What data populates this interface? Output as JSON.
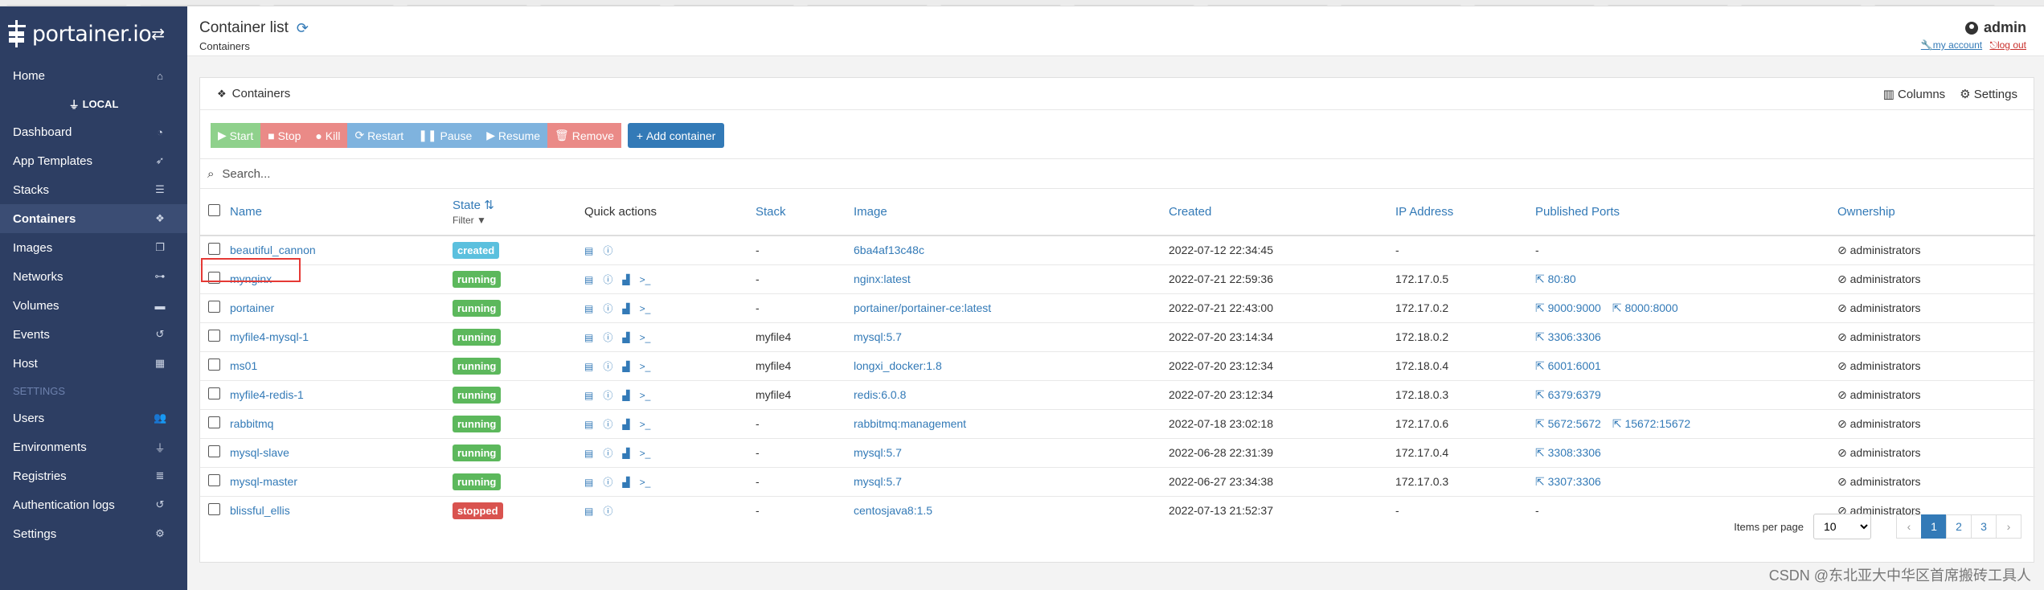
{
  "sidebar": {
    "brand": "portainer.io",
    "environment": "LOCAL",
    "settings_section": "SETTINGS",
    "items": [
      {
        "label": "Home",
        "icon": "home-icon"
      },
      {
        "label": "Dashboard",
        "icon": "tachometer-icon"
      },
      {
        "label": "App Templates",
        "icon": "rocket-icon"
      },
      {
        "label": "Stacks",
        "icon": "list-icon"
      },
      {
        "label": "Containers",
        "icon": "cubes-icon"
      },
      {
        "label": "Images",
        "icon": "clone-icon"
      },
      {
        "label": "Networks",
        "icon": "sitemap-icon"
      },
      {
        "label": "Volumes",
        "icon": "hdd-icon"
      },
      {
        "label": "Events",
        "icon": "history-icon"
      },
      {
        "label": "Host",
        "icon": "th-icon"
      }
    ],
    "settings_items": [
      {
        "label": "Users",
        "icon": "users-icon"
      },
      {
        "label": "Environments",
        "icon": "plug-icon"
      },
      {
        "label": "Registries",
        "icon": "database-icon"
      },
      {
        "label": "Authentication logs",
        "icon": "history-icon"
      },
      {
        "label": "Settings",
        "icon": "cogs-icon"
      }
    ]
  },
  "header": {
    "title": "Container list",
    "breadcrumb": "Containers",
    "user": "admin",
    "my_account": "my account",
    "log_out": "log out"
  },
  "panel": {
    "title": "Containers",
    "columns_label": "Columns",
    "settings_label": "Settings"
  },
  "toolbar": {
    "start": "Start",
    "stop": "Stop",
    "kill": "Kill",
    "restart": "Restart",
    "pause": "Pause",
    "resume": "Resume",
    "remove": "Remove",
    "add": "Add container"
  },
  "search": {
    "placeholder": "Search..."
  },
  "table": {
    "headers": {
      "name": "Name",
      "state": "State",
      "filter": "Filter",
      "quick_actions": "Quick actions",
      "stack": "Stack",
      "image": "Image",
      "created": "Created",
      "ip": "IP Address",
      "ports": "Published Ports",
      "ownership": "Ownership"
    },
    "rows": [
      {
        "name": "beautiful_cannon",
        "state": "created",
        "stack": "-",
        "image": "6ba4af13c48c",
        "created": "2022-07-12 22:34:45",
        "ip": "-",
        "ports": [
          "-"
        ],
        "ownership": "administrators"
      },
      {
        "name": "mynginx",
        "state": "running",
        "stack": "-",
        "image": "nginx:latest",
        "created": "2022-07-21 22:59:36",
        "ip": "172.17.0.5",
        "ports": [
          "80:80"
        ],
        "ownership": "administrators"
      },
      {
        "name": "portainer",
        "state": "running",
        "stack": "-",
        "image": "portainer/portainer-ce:latest",
        "created": "2022-07-21 22:43:00",
        "ip": "172.17.0.2",
        "ports": [
          "9000:9000",
          "8000:8000"
        ],
        "ownership": "administrators"
      },
      {
        "name": "myfile4-mysql-1",
        "state": "running",
        "stack": "myfile4",
        "image": "mysql:5.7",
        "created": "2022-07-20 23:14:34",
        "ip": "172.18.0.2",
        "ports": [
          "3306:3306"
        ],
        "ownership": "administrators"
      },
      {
        "name": "ms01",
        "state": "running",
        "stack": "myfile4",
        "image": "longxi_docker:1.8",
        "created": "2022-07-20 23:12:34",
        "ip": "172.18.0.4",
        "ports": [
          "6001:6001"
        ],
        "ownership": "administrators"
      },
      {
        "name": "myfile4-redis-1",
        "state": "running",
        "stack": "myfile4",
        "image": "redis:6.0.8",
        "created": "2022-07-20 23:12:34",
        "ip": "172.18.0.3",
        "ports": [
          "6379:6379"
        ],
        "ownership": "administrators"
      },
      {
        "name": "rabbitmq",
        "state": "running",
        "stack": "-",
        "image": "rabbitmq:management",
        "created": "2022-07-18 23:02:18",
        "ip": "172.17.0.6",
        "ports": [
          "5672:5672",
          "15672:15672"
        ],
        "ownership": "administrators"
      },
      {
        "name": "mysql-slave",
        "state": "running",
        "stack": "-",
        "image": "mysql:5.7",
        "created": "2022-06-28 22:31:39",
        "ip": "172.17.0.4",
        "ports": [
          "3308:3306"
        ],
        "ownership": "administrators"
      },
      {
        "name": "mysql-master",
        "state": "running",
        "stack": "-",
        "image": "mysql:5.7",
        "created": "2022-06-27 23:34:38",
        "ip": "172.17.0.3",
        "ports": [
          "3307:3306"
        ],
        "ownership": "administrators"
      },
      {
        "name": "blissful_ellis",
        "state": "stopped",
        "stack": "-",
        "image": "centosjava8:1.5",
        "created": "2022-07-13 21:52:37",
        "ip": "-",
        "ports": [
          "-"
        ],
        "ownership": "administrators"
      }
    ]
  },
  "pagination": {
    "items_per_page_label": "Items per page",
    "items_per_page": "10",
    "prev": "‹",
    "next": "›",
    "pages": [
      "1",
      "2",
      "3"
    ],
    "current": "1"
  },
  "watermark": "CSDN @东北亚大中华区首席搬砖工具人",
  "colors": {
    "sidebar_bg": "#2d3e63",
    "link": "#337ab7",
    "running": "#5cb85c",
    "created": "#5bc0de",
    "stopped": "#d9534f"
  }
}
